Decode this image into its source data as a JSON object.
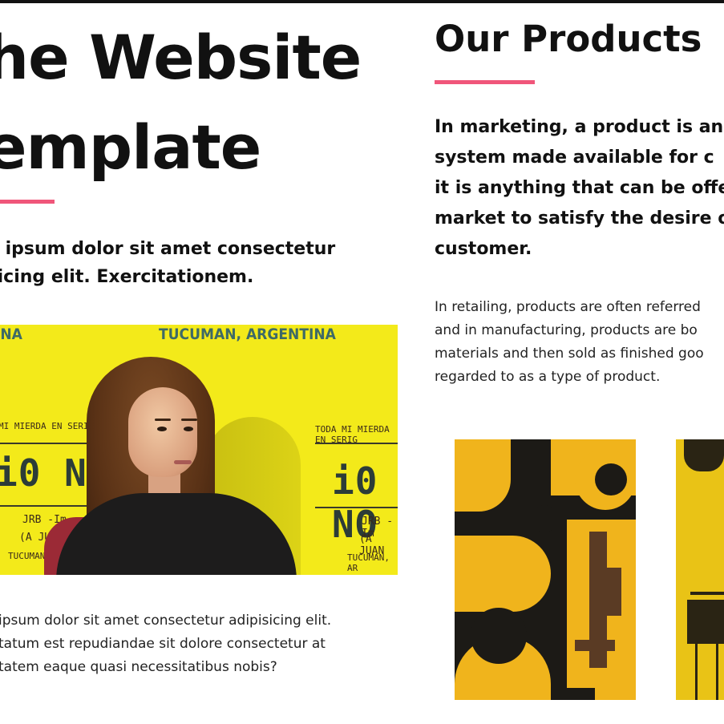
{
  "hero": {
    "title_line1": "he Website",
    "title_line2": "emplate",
    "lead_line1": "m ipsum dolor sit amet consectetur",
    "lead_line2": "isicing elit. Exercitationem.",
    "photo": {
      "poster_top_left": "INA",
      "poster_top_right": "TUCUMAN, ARGENTINA",
      "left_small": "MI MIERDA EN SERIGRAFI",
      "left_big": "i0 NO S",
      "left_sub1": "JRB -Im",
      "left_sub2": "(A JUAN",
      "left_sub3": "TUCUMAN",
      "right_small": "TODA MI MIERDA EN SERIG",
      "right_big": "i0 NO",
      "right_sub1": "JRB -Im",
      "right_sub2": "(A JUAN",
      "right_sub3": "TUCUMAN, AR"
    },
    "body_line1": "ipsum dolor sit amet consectetur adipisicing elit.",
    "body_line2": "tatum est repudiandae sit dolore consectetur at",
    "body_line3": "tatem eaque quasi necessitatibus nobis?"
  },
  "products": {
    "title": "Our Products",
    "lead_line1": "In marketing, a product is an",
    "lead_line2": "system made available for c",
    "lead_line3": "it is anything that can be offe",
    "lead_line4": "market to satisfy the desire o",
    "lead_line5": "customer.",
    "body_line1": "In retailing, products are often referred",
    "body_line2": "and in manufacturing, products are bo",
    "body_line3": "materials and then sold as finished goo",
    "body_line4": "regarded to as a type of product."
  },
  "colors": {
    "accent": "#f0567a",
    "text": "#111111",
    "yellow": "#f3ea1a"
  }
}
